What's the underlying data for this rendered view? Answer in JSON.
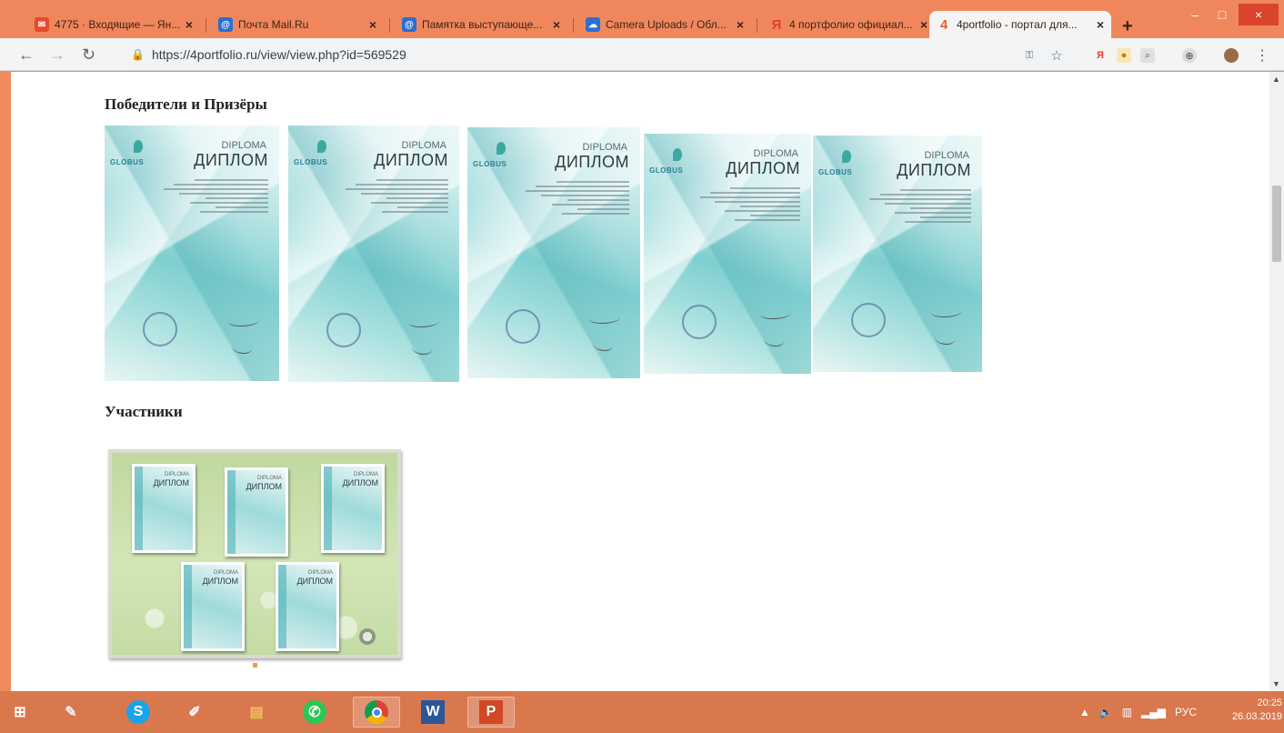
{
  "browser": {
    "tabs": [
      {
        "label": "4775 · Входящие — Ян...",
        "icon": "yandex-mail-icon",
        "color": "#e54b2a"
      },
      {
        "label": "Почта Mail.Ru",
        "icon": "mail-ru-icon",
        "color": "#2b6fd6"
      },
      {
        "label": "Памятка выступающе...",
        "icon": "mail-ru-icon",
        "color": "#2b6fd6"
      },
      {
        "label": "Camera Uploads / Обл...",
        "icon": "cloud-icon",
        "color": "#2b6fd6"
      },
      {
        "label": "4 портфолио официал...",
        "icon": "yandex-icon",
        "color": "#e53b2a"
      },
      {
        "label": "4portfolio - портал для...",
        "icon": "4portfolio-icon",
        "color": "#e5612a",
        "active": true
      }
    ],
    "new_tab": "+",
    "window_buttons": {
      "minimize": "–",
      "maximize": "□",
      "close": "×"
    },
    "url": "https://4portfolio.ru/view/view.php?id=569529"
  },
  "page": {
    "sections": [
      {
        "title": "Победители и Призёры",
        "diplomas": [
          {
            "logo": "GLOBUS",
            "heading_en": "DIPLOMA",
            "heading_ru": "ДИПЛОМ"
          },
          {
            "logo": "GLOBUS",
            "heading_en": "DIPLOMA",
            "heading_ru": "ДИПЛОМ"
          },
          {
            "logo": "GLOBUS",
            "heading_en": "DIPLOMA",
            "heading_ru": "ДИПЛОМ"
          },
          {
            "logo": "GLOBUS",
            "heading_en": "DIPLOMA",
            "heading_ru": "ДИПЛОМ"
          },
          {
            "logo": "GLOBUS",
            "heading_en": "DIPLOMA",
            "heading_ru": "ДИПЛОМ"
          }
        ]
      },
      {
        "title": "Участники"
      }
    ]
  },
  "taskbar": {
    "apps": [
      {
        "name": "start-button",
        "glyph": "⊞"
      },
      {
        "name": "paint-app",
        "glyph": "✎"
      },
      {
        "name": "skype-app",
        "glyph": "S",
        "color": "#1aa3e8"
      },
      {
        "name": "pen-app",
        "glyph": "✐"
      },
      {
        "name": "file-explorer",
        "glyph": "▤",
        "color": "#e8c45a"
      },
      {
        "name": "whatsapp-app",
        "glyph": "✆",
        "color": "#2cc655"
      },
      {
        "name": "chrome-app",
        "glyph": "◉",
        "color": "#e9b32a",
        "active": true
      },
      {
        "name": "word-app",
        "glyph": "W",
        "color": "#2b579a"
      },
      {
        "name": "powerpoint-app",
        "glyph": "P",
        "color": "#d24726",
        "active": true
      }
    ],
    "language": "РУС",
    "time": "20:25",
    "date": "26.03.2019"
  }
}
